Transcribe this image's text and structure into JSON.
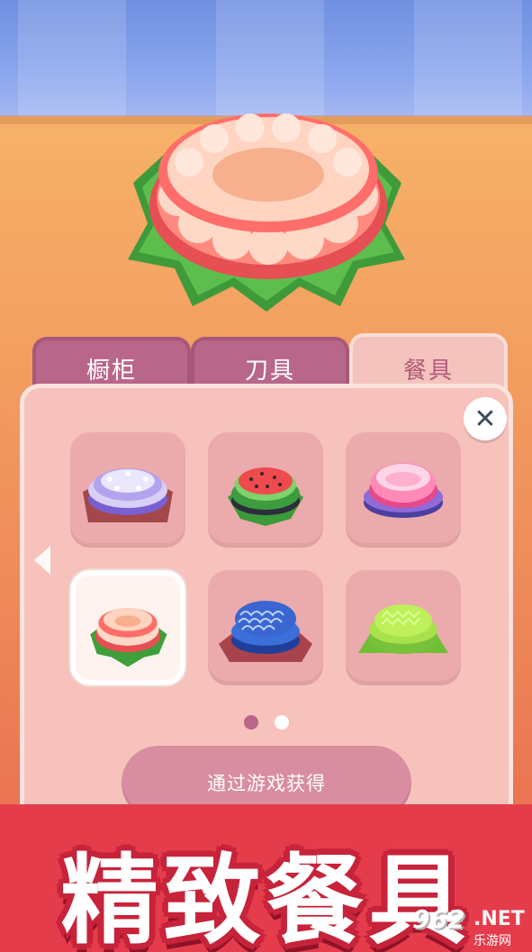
{
  "tabs": [
    {
      "label": "橱柜",
      "active": false
    },
    {
      "label": "刀具",
      "active": false
    },
    {
      "label": "餐具",
      "active": true
    }
  ],
  "panel": {
    "close_icon": "close-icon",
    "prev_icon": "chevron-left-icon",
    "items": [
      {
        "name": "lavender-plate",
        "selected": false
      },
      {
        "name": "watermelon-plate",
        "selected": false
      },
      {
        "name": "pink-purple-bowl",
        "selected": false
      },
      {
        "name": "flower-bowl",
        "selected": true
      },
      {
        "name": "wave-bowl",
        "selected": false
      },
      {
        "name": "lime-plate",
        "selected": false
      }
    ],
    "pages": {
      "current": 1,
      "total": 2
    },
    "unlock_button": "通过游戏获得"
  },
  "promo": {
    "title": "精致餐具"
  },
  "watermark": {
    "number": "962",
    "net": ".NET",
    "site": "乐游网"
  },
  "colors": {
    "tab_inactive": "#b9668b",
    "tab_active": "#f5c3bd",
    "panel": "#f6c2bb",
    "banner": "#e53c4c",
    "button": "#d98da0"
  }
}
